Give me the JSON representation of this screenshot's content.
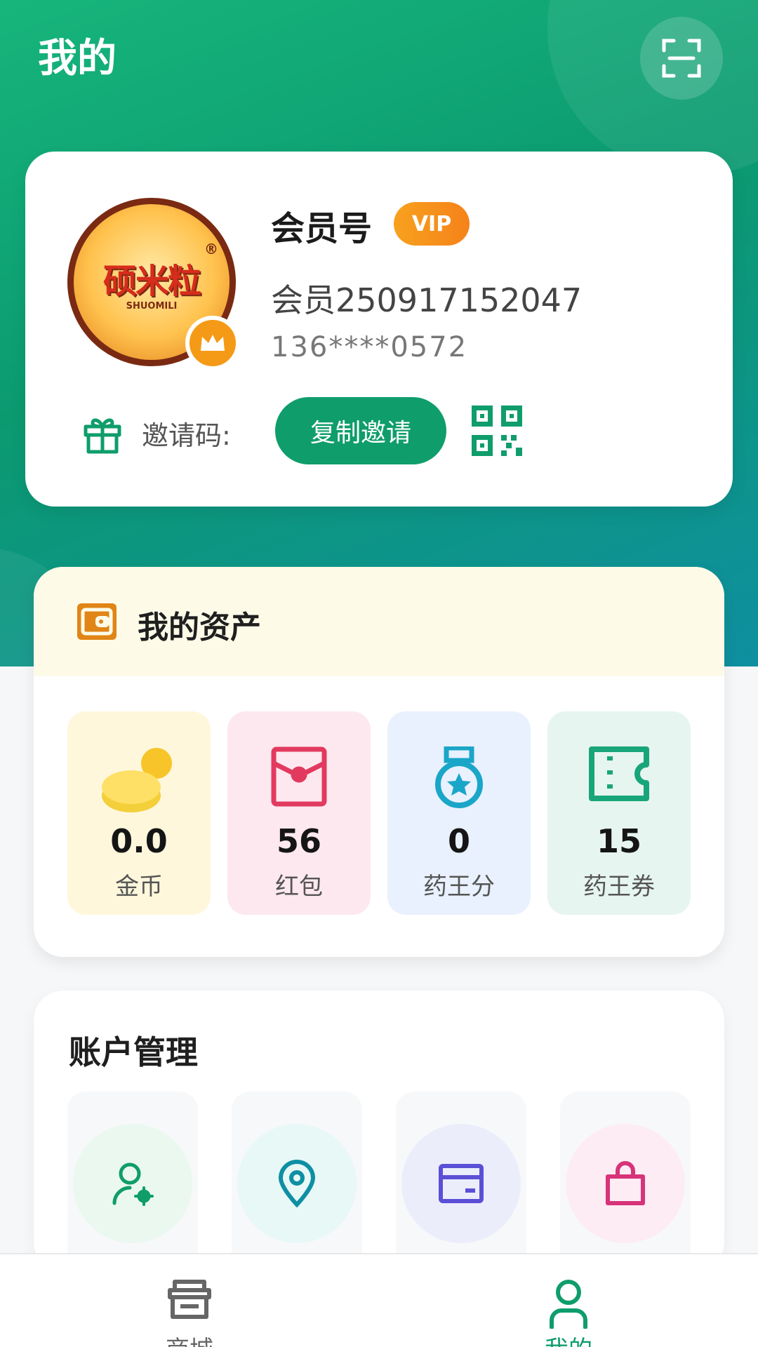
{
  "header": {
    "title": "我的"
  },
  "profile": {
    "avatar_brand": "硕米粒",
    "avatar_sub": "SHUOMILI",
    "avatar_reg": "®",
    "member_title": "会员号",
    "vip_badge": "VIP",
    "member_id": "会员250917152047",
    "phone": "136****0572",
    "invite_label": "邀请码:",
    "copy_button": "复制邀请"
  },
  "assets": {
    "title": "我的资产",
    "items": [
      {
        "value": "0.0",
        "label": "金币",
        "icon": "coins-icon",
        "bg": "#fff7dc"
      },
      {
        "value": "56",
        "label": "红包",
        "icon": "red-envelope-icon",
        "bg": "#fde8ef"
      },
      {
        "value": "0",
        "label": "药王分",
        "icon": "medal-icon",
        "bg": "#e8f1fd"
      },
      {
        "value": "15",
        "label": "药王券",
        "icon": "ticket-icon",
        "bg": "#e6f5ef"
      }
    ]
  },
  "account": {
    "title": "账户管理",
    "items": [
      {
        "icon": "user-settings-icon",
        "color": "#0f9d6b"
      },
      {
        "icon": "location-pin-icon",
        "color": "#0e8fa3"
      },
      {
        "icon": "card-icon",
        "color": "#5b4fd6"
      },
      {
        "icon": "shopping-bag-icon",
        "color": "#d6337a"
      }
    ]
  },
  "tabbar": {
    "items": [
      {
        "label": "商城",
        "icon": "store-icon",
        "active": false
      },
      {
        "label": "我的",
        "icon": "profile-icon",
        "active": true
      }
    ]
  },
  "colors": {
    "accent": "#0f9d6b",
    "vip": "#f5821a",
    "inactive": "#666666"
  }
}
